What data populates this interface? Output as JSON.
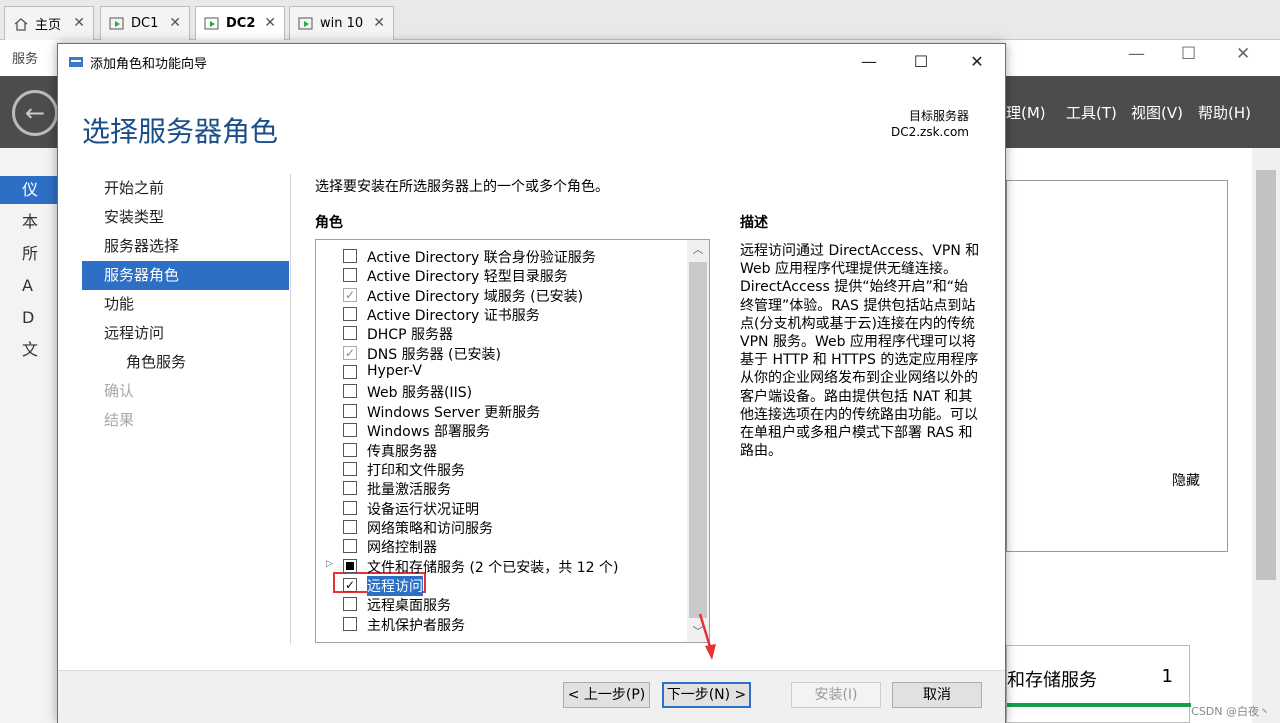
{
  "vm_tabs": [
    {
      "label": "主页",
      "active": false
    },
    {
      "label": "DC1",
      "active": false
    },
    {
      "label": "DC2",
      "active": true
    },
    {
      "label": "win 10",
      "active": false
    }
  ],
  "bg": {
    "title": "服务",
    "menu": [
      "理(M)",
      "工具(T)",
      "视图(V)",
      "帮助(H)"
    ],
    "side_items": [
      "仪",
      "本",
      "所",
      "A",
      "D",
      "文"
    ],
    "hide_label": "隐藏",
    "card_title": "和存储服务",
    "card_count": "1",
    "watermark": "CSDN @白夜丶"
  },
  "wizard": {
    "window_title": "添加角色和功能向导",
    "heading": "选择服务器角色",
    "target_label": "目标服务器",
    "target_value": "DC2.zsk.com",
    "nav": [
      {
        "label": "开始之前",
        "state": "normal",
        "sub": false
      },
      {
        "label": "安装类型",
        "state": "normal",
        "sub": false
      },
      {
        "label": "服务器选择",
        "state": "normal",
        "sub": false
      },
      {
        "label": "服务器角色",
        "state": "selected",
        "sub": false
      },
      {
        "label": "功能",
        "state": "normal",
        "sub": false
      },
      {
        "label": "远程访问",
        "state": "normal",
        "sub": false
      },
      {
        "label": "角色服务",
        "state": "normal",
        "sub": true
      },
      {
        "label": "确认",
        "state": "disabled",
        "sub": false
      },
      {
        "label": "结果",
        "state": "disabled",
        "sub": false
      }
    ],
    "instruction": "选择要安装在所选服务器上的一个或多个角色。",
    "roles_heading": "角色",
    "description_heading": "描述",
    "description": "远程访问通过 DirectAccess、VPN 和 Web 应用程序代理提供无缝连接。DirectAccess 提供“始终开启”和“始终管理”体验。RAS 提供包括站点到站点(分支机构或基于云)连接在内的传统 VPN 服务。Web 应用程序代理可以将基于 HTTP 和 HTTPS 的选定应用程序从你的企业网络发布到企业网络以外的客户端设备。路由提供包括 NAT 和其他连接选项在内的传统路由功能。可以在单租户或多租户模式下部署 RAS 和路由。",
    "roles": [
      {
        "label": "Active Directory 联合身份验证服务",
        "state": "unchecked"
      },
      {
        "label": "Active Directory 轻型目录服务",
        "state": "unchecked"
      },
      {
        "label": "Active Directory 域服务 (已安装)",
        "state": "installed"
      },
      {
        "label": "Active Directory 证书服务",
        "state": "unchecked"
      },
      {
        "label": "DHCP 服务器",
        "state": "unchecked"
      },
      {
        "label": "DNS 服务器 (已安装)",
        "state": "installed"
      },
      {
        "label": "Hyper-V",
        "state": "unchecked"
      },
      {
        "label": "Web 服务器(IIS)",
        "state": "unchecked"
      },
      {
        "label": "Windows Server 更新服务",
        "state": "unchecked"
      },
      {
        "label": "Windows 部署服务",
        "state": "unchecked"
      },
      {
        "label": "传真服务器",
        "state": "unchecked"
      },
      {
        "label": "打印和文件服务",
        "state": "unchecked"
      },
      {
        "label": "批量激活服务",
        "state": "unchecked"
      },
      {
        "label": "设备运行状况证明",
        "state": "unchecked"
      },
      {
        "label": "网络策略和访问服务",
        "state": "unchecked"
      },
      {
        "label": "网络控制器",
        "state": "unchecked"
      },
      {
        "label": "文件和存储服务 (2 个已安装，共 12 个)",
        "state": "partial",
        "expandable": true
      },
      {
        "label": "远程访问",
        "state": "checked",
        "highlighted": true
      },
      {
        "label": "远程桌面服务",
        "state": "unchecked"
      },
      {
        "label": "主机保护者服务",
        "state": "unchecked"
      }
    ],
    "buttons": {
      "prev": "< 上一步(P)",
      "next": "下一步(N) >",
      "install": "安装(I)",
      "cancel": "取消"
    }
  },
  "colors": {
    "accent": "#2d6fc4",
    "heading": "#1a4e8a",
    "highlight_box": "#e53333",
    "arrow": "#e53333"
  }
}
